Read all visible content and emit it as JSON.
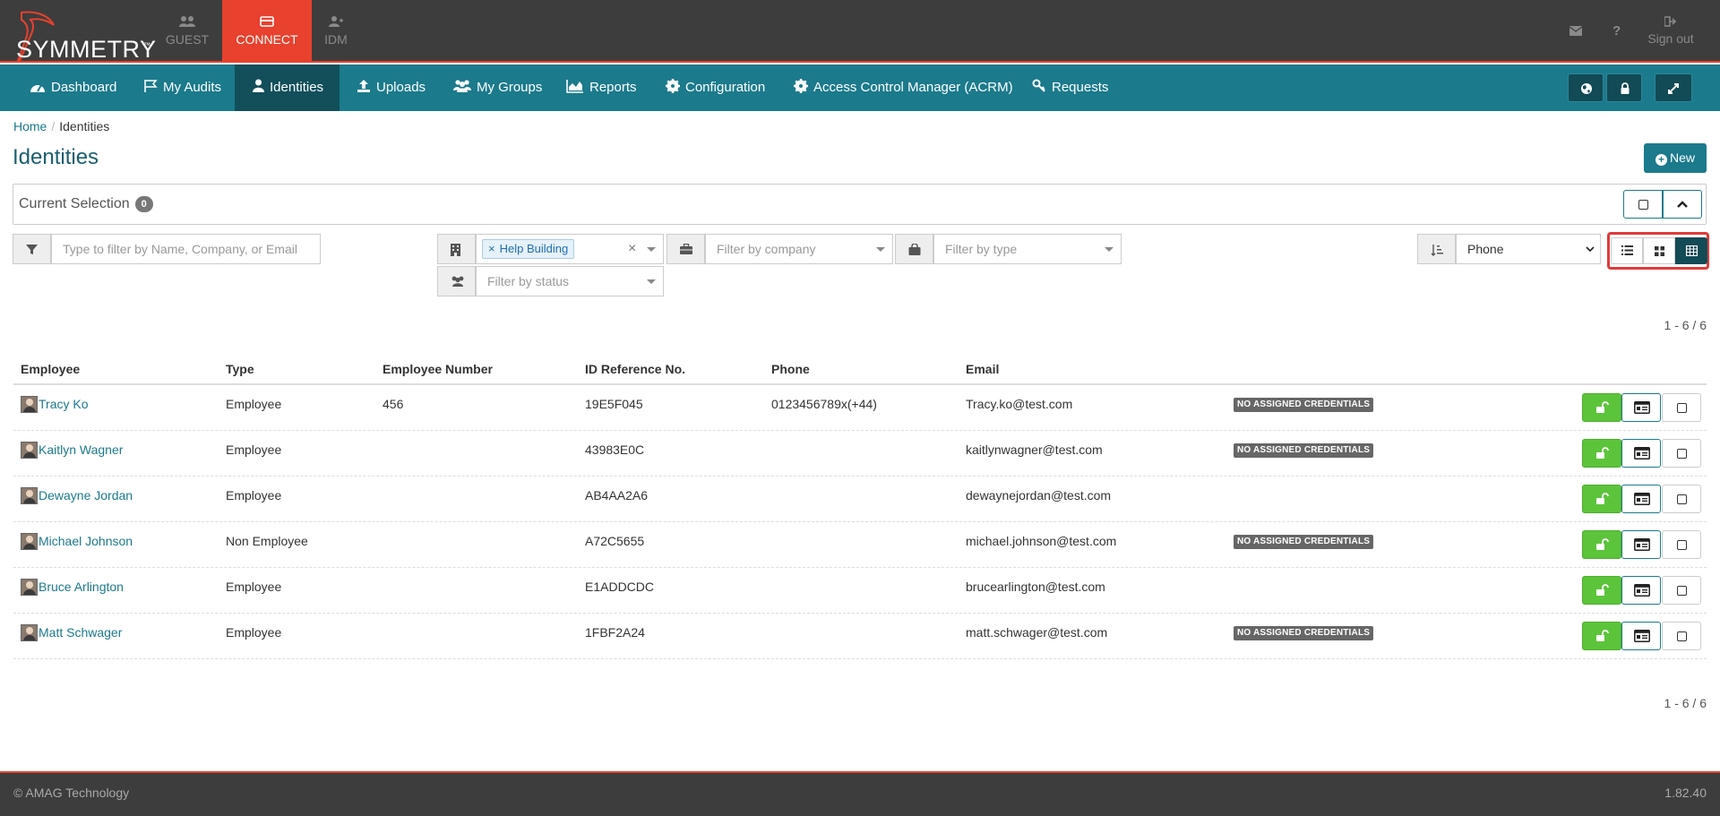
{
  "brand": {
    "name": "SYMMETRY",
    "tm": "™"
  },
  "top_tabs": [
    {
      "label": "GUEST",
      "icon": "users-icon"
    },
    {
      "label": "CONNECT",
      "icon": "card-icon",
      "active": true
    },
    {
      "label": "IDM",
      "icon": "user-plus-icon"
    }
  ],
  "top_right": {
    "mail_icon": "envelope-icon",
    "help_icon": "question-icon",
    "signout_label": "Sign out"
  },
  "nav": [
    {
      "label": "Dashboard",
      "icon": "dashboard-icon"
    },
    {
      "label": "My Audits",
      "icon": "flag-icon"
    },
    {
      "label": "Identities",
      "icon": "user-icon",
      "active": true
    },
    {
      "label": "Uploads",
      "icon": "upload-icon"
    },
    {
      "label": "My Groups",
      "icon": "group-icon"
    },
    {
      "label": "Reports",
      "icon": "area-chart-icon"
    },
    {
      "label": "Configuration",
      "icon": "gear-icon"
    },
    {
      "label": "Access Control Manager (ACRM)",
      "icon": "gear-icon"
    },
    {
      "label": "Requests",
      "icon": "key-icon"
    }
  ],
  "breadcrumb": {
    "home": "Home",
    "current": "Identities"
  },
  "page": {
    "title": "Identities",
    "new_label": "New"
  },
  "selection": {
    "label": "Current Selection",
    "count": "0"
  },
  "filters": {
    "search_placeholder": "Type to filter by Name, Company, or Email",
    "building_chip": "Help Building",
    "company_placeholder": "Filter by company",
    "type_placeholder": "Filter by type",
    "status_placeholder": "Filter by status",
    "sort_value": "Phone",
    "sort_options": [
      "Phone"
    ]
  },
  "pagination": {
    "top": "1 - 6 / 6",
    "bottom": "1 - 6 / 6"
  },
  "table": {
    "headers": [
      "Employee",
      "Type",
      "Employee Number",
      "ID Reference No.",
      "Phone",
      "Email"
    ],
    "badge_label": "NO ASSIGNED CREDENTIALS",
    "rows": [
      {
        "name": "Tracy Ko",
        "type": "Employee",
        "number": "456",
        "idref": "19E5F045",
        "phone": "0123456789x(+44)",
        "email": "Tracy.ko@test.com",
        "no_creds": "NO ASSIGNED CREDENTIALS"
      },
      {
        "name": "Kaitlyn Wagner",
        "type": "Employee",
        "number": "",
        "idref": "43983E0C",
        "phone": "",
        "email": "kaitlynwagner@test.com",
        "no_creds": "NO ASSIGNED CREDENTIALS"
      },
      {
        "name": "Dewayne Jordan",
        "type": "Employee",
        "number": "",
        "idref": "AB4AA2A6",
        "phone": "",
        "email": "dewaynejordan@test.com",
        "no_creds": ""
      },
      {
        "name": "Michael Johnson",
        "type": "Non Employee",
        "number": "",
        "idref": "A72C5655",
        "phone": "",
        "email": "michael.johnson@test.com",
        "no_creds": "NO ASSIGNED CREDENTIALS"
      },
      {
        "name": "Bruce Arlington",
        "type": "Employee",
        "number": "",
        "idref": "E1ADDCDC",
        "phone": "",
        "email": "brucearlington@test.com",
        "no_creds": ""
      },
      {
        "name": "Matt Schwager",
        "type": "Employee",
        "number": "",
        "idref": "1FBF2A24",
        "phone": "",
        "email": "matt.schwager@test.com",
        "no_creds": "NO ASSIGNED CREDENTIALS"
      }
    ]
  },
  "footer": {
    "copyright": "© AMAG Technology",
    "version": "1.82.40"
  },
  "colors": {
    "accent_red": "#e8412e",
    "nav_teal": "#1b7a8c",
    "green": "#5cc43a"
  }
}
